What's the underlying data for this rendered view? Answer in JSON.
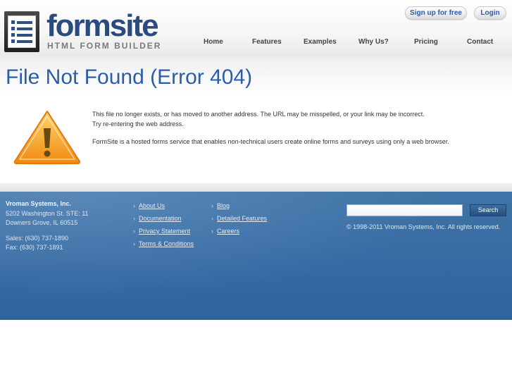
{
  "header": {
    "logo_word": "formsite",
    "logo_sub": "HTML FORM BUILDER",
    "signup_label": "Sign up for free",
    "login_label": "Login",
    "nav": [
      "Home",
      "Features",
      "Examples",
      "Why Us?",
      "Pricing",
      "Contact"
    ]
  },
  "main": {
    "title": "File Not Found (Error 404)",
    "line1": "This file no longer exists, or has moved to another address. The URL may be misspelled, or your link may be incorrect.",
    "line2": "Try re-entering the web address.",
    "line3": "FormSite is a hosted forms service that enables non-technical users create online forms and surveys using only a web browser."
  },
  "footer": {
    "company": "Vroman Systems, Inc.",
    "address1": "5202 Washington St. STE: 11",
    "address2": "Downers Grove, IL 60515",
    "sales": "Sales: (630) 737-1890",
    "fax": "Fax: (630) 737-1891",
    "links_col1": [
      "About Us",
      "Documentation",
      "Privacy Statement",
      "Terms & Conditions"
    ],
    "links_col2": [
      "Blog",
      "Detailed Features",
      "Careers"
    ],
    "search_button": "Search",
    "copyright": "© 1998-2011 Vroman Systems, Inc. All rights reserved."
  },
  "colors": {
    "brand_blue": "#2b5da8",
    "footer_blue": "#2f62a0",
    "warning_orange": "#f39a1b"
  }
}
